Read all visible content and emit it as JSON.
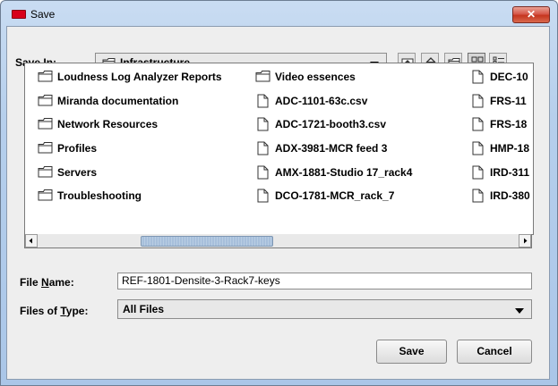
{
  "window": {
    "title": "Save",
    "close_glyph": "✕"
  },
  "save_in": {
    "label_pre": "Save ",
    "label_mnemonic": "I",
    "label_post": "n:",
    "value": "Infrastructure",
    "value_icon": "folder-icon"
  },
  "toolbar": {
    "buttons": [
      "up-one-level-icon",
      "home-icon",
      "new-folder-icon",
      "list-view-icon",
      "details-view-icon"
    ]
  },
  "file_list": {
    "columns": [
      [
        {
          "name": "Loudness Log Analyzer Reports",
          "type": "folder"
        },
        {
          "name": "Miranda documentation",
          "type": "folder"
        },
        {
          "name": "Network Resources",
          "type": "folder"
        },
        {
          "name": "Profiles",
          "type": "folder"
        },
        {
          "name": "Servers",
          "type": "folder"
        },
        {
          "name": "Troubleshooting",
          "type": "folder"
        }
      ],
      [
        {
          "name": "Video essences",
          "type": "folder"
        },
        {
          "name": "ADC-1101-63c.csv",
          "type": "file"
        },
        {
          "name": "ADC-1721-booth3.csv",
          "type": "file"
        },
        {
          "name": "ADX-3981-MCR feed 3",
          "type": "file"
        },
        {
          "name": "AMX-1881-Studio 17_rack4",
          "type": "file"
        },
        {
          "name": "DCO-1781-MCR_rack_7",
          "type": "file"
        }
      ],
      [
        {
          "name": "DEC-10",
          "type": "file"
        },
        {
          "name": "FRS-11",
          "type": "file"
        },
        {
          "name": "FRS-18",
          "type": "file"
        },
        {
          "name": "HMP-18",
          "type": "file"
        },
        {
          "name": "IRD-311",
          "type": "file"
        },
        {
          "name": "IRD-380",
          "type": "file"
        }
      ]
    ]
  },
  "file_name": {
    "label_pre": "File ",
    "label_mnemonic": "N",
    "label_post": "ame:",
    "value": "REF-1801-Densite-3-Rack7-keys"
  },
  "file_type": {
    "label_pre": "Files of ",
    "label_mnemonic": "T",
    "label_post": "ype:",
    "value": "All Files"
  },
  "buttons": {
    "save": "Save",
    "cancel": "Cancel"
  }
}
